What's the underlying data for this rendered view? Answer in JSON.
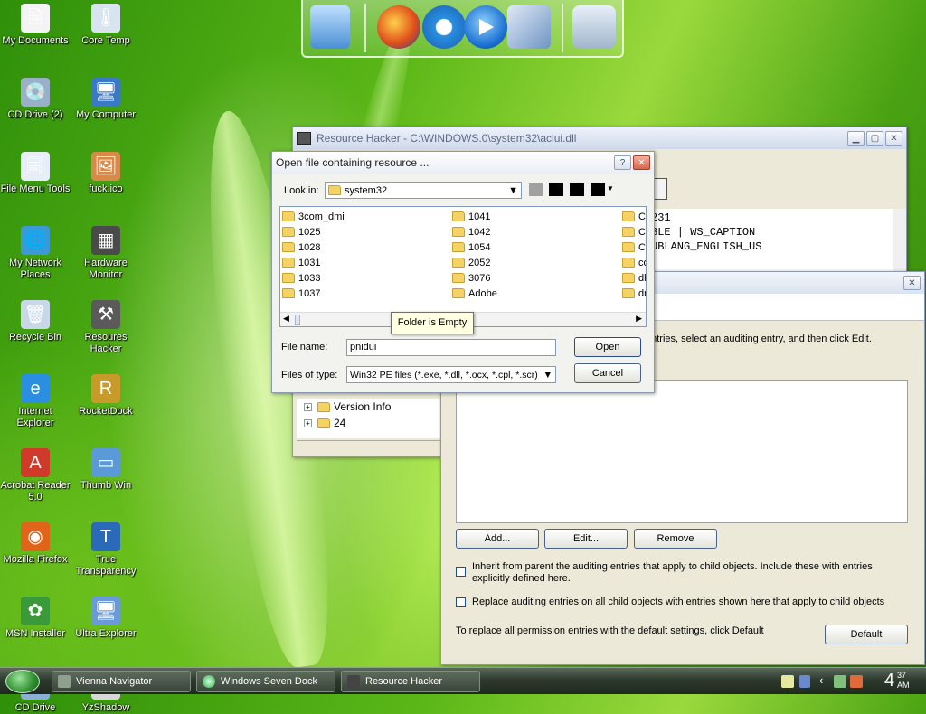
{
  "desktop": {
    "icons": [
      {
        "label": "My Documents",
        "glyph": "🗎"
      },
      {
        "label": "Core Temp",
        "glyph": "🌡"
      },
      {
        "label": "CD Drive (2)",
        "glyph": "💿"
      },
      {
        "label": "My Computer",
        "glyph": "🖥"
      },
      {
        "label": "File Menu Tools",
        "glyph": "🗐"
      },
      {
        "label": "fuck.ico",
        "glyph": "🖼"
      },
      {
        "label": "My Network Places",
        "glyph": "🌐"
      },
      {
        "label": "Hardware Monitor",
        "glyph": "▦"
      },
      {
        "label": "Recycle Bin",
        "glyph": "🗑"
      },
      {
        "label": "Resoures Hacker",
        "glyph": "⚒"
      },
      {
        "label": "Internet Explorer",
        "glyph": "e"
      },
      {
        "label": "RocketDock",
        "glyph": "R"
      },
      {
        "label": "Acrobat Reader 5.0",
        "glyph": "A"
      },
      {
        "label": "Thumb Win",
        "glyph": "▭"
      },
      {
        "label": "Mozilla Firefox",
        "glyph": "◉"
      },
      {
        "label": "True Transparency",
        "glyph": "T"
      },
      {
        "label": "MSN Installer",
        "glyph": "✿"
      },
      {
        "label": "Ultra Explorer",
        "glyph": "🖥"
      },
      {
        "label": "CD Drive",
        "glyph": "💿"
      },
      {
        "label": "YzShadow",
        "glyph": "▤"
      }
    ]
  },
  "dock": {
    "items": [
      "monitor-icon",
      "firefox-icon",
      "internet-explorer-icon",
      "media-player-icon",
      "control-panel-icon",
      "recycle-bin-icon"
    ]
  },
  "resource_hacker": {
    "title": "Resource Hacker   -   C:\\WINDOWS.0\\system32\\aclui.dll",
    "code_lines": [
      "231",
      "BLE | WS_CAPTION",
      "",
      "UBLANG_ENGLISH_US"
    ],
    "tree": [
      {
        "label": "Version Info"
      },
      {
        "label": "24"
      }
    ]
  },
  "open_dialog": {
    "title": "Open file containing resource ...",
    "help_label": "?",
    "close_label": "✕",
    "look_in_label": "Look in:",
    "look_in_value": "system32",
    "col1": [
      "3com_dmi",
      "1025",
      "1028",
      "1031",
      "1033",
      "1037"
    ],
    "col2": [
      "1041",
      "1042",
      "1054",
      "2052",
      "3076",
      "Adobe"
    ],
    "col3": [
      "Ca",
      "Ca",
      "Cc",
      "co",
      "dh",
      "dr"
    ],
    "tooltip": "Folder is Empty",
    "file_name_label": "File name:",
    "file_name_value": "pnidui",
    "files_of_type_label": "Files of type:",
    "files_of_type_value": "Win32 PE files (*.exe, *.dll, *.ocx, *.cpl, *.scr)",
    "open_label": "Open",
    "cancel_label": "Cancel"
  },
  "audit_dialog": {
    "close_label": "✕",
    "instruction": "entries, select an auditing entry, and then click Edit.",
    "add_label": "Add...",
    "edit_label": "Edit...",
    "remove_label": "Remove",
    "inherit_label": "Inherit from parent the auditing entries that apply to child objects. Include these with entries explicitly defined here.",
    "replace_label": "Replace auditing entries on all child objects with entries shown here that apply to child objects",
    "default_hint": "To replace all permission entries with the default settings, click Default",
    "default_label": "Default"
  },
  "taskbar": {
    "tasks": [
      "Vienna Navigator",
      "Windows Seven Dock",
      "Resource Hacker"
    ],
    "clock_hour": "4",
    "clock_minutes": "37",
    "clock_ampm": "AM"
  }
}
